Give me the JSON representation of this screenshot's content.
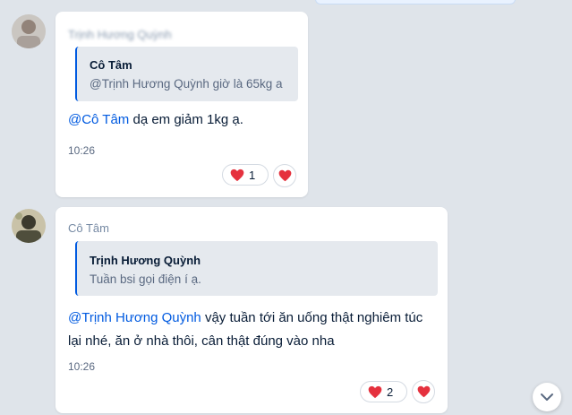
{
  "messages": [
    {
      "sender": "Trịnh Hương Quỳnh",
      "quote": {
        "author": "Cô Tâm",
        "text": "@Trịnh Hương Quỳnh giờ là 65kg a"
      },
      "mention": "@Cô Tâm",
      "text": " dạ em giảm 1kg ạ.",
      "time": "10:26",
      "reaction_count": "1"
    },
    {
      "sender": "Cô Tâm",
      "quote": {
        "author": "Trịnh Hương Quỳnh",
        "text": "Tuần bsi gọi điện í ạ."
      },
      "mention": "@Trịnh Hương Quỳnh",
      "text_line1": " vậy tuần tới ăn uống thật nghiêm túc",
      "text_line2": "lại nhé, ăn ở nhà thôi, cân thật đúng vào nha",
      "time": "10:26",
      "reaction_count": "2"
    }
  ],
  "icons": {
    "reaction": "heart-icon",
    "scroll": "chevron-down-icon"
  },
  "colors": {
    "background": "#dfe4ea",
    "mention": "#005ae0",
    "heart": "#e5313e"
  }
}
